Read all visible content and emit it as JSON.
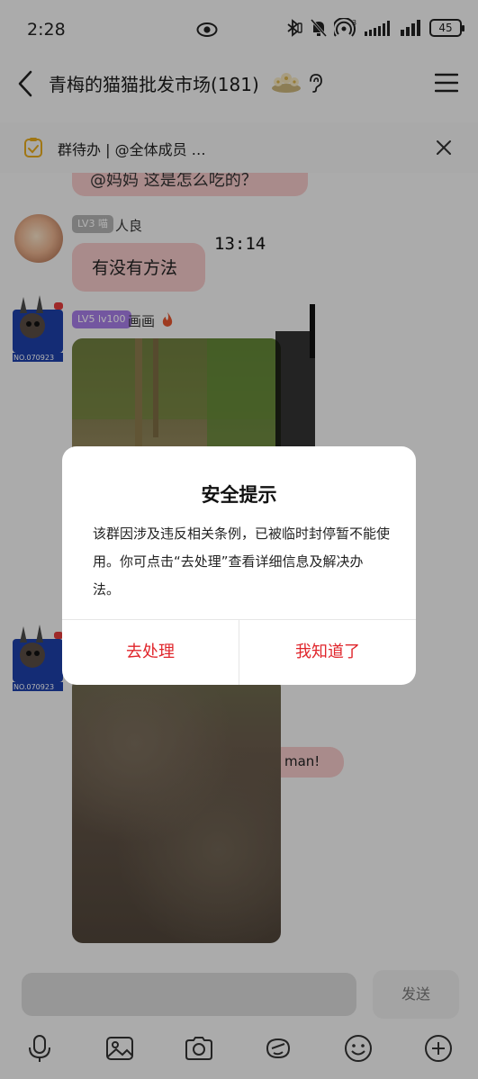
{
  "status_bar": {
    "time": "2:28",
    "battery": "45"
  },
  "header": {
    "title": "青梅的猫猫批发市场(181)"
  },
  "todo_bar": {
    "text": "群待办 | @全体成员 …"
  },
  "chat": {
    "top_bubble_text": "@妈妈 这是怎么吃的？",
    "message1": {
      "level": "LV3 喵",
      "sender": "人良",
      "text": "有没有方法",
      "handwritten_note": "13:14"
    },
    "message2": {
      "level": "LV5 lv100",
      "sender": "画画"
    },
    "avatar_badge": "NO.070923",
    "partial_bubble_text": "man!"
  },
  "input": {
    "send_label": "发送"
  },
  "dialog": {
    "title": "安全提示",
    "body": "该群因涉及违反相关条例，已被临时封停暂不能使用。你可点击“去处理”查看详细信息及解决办法。",
    "left_button": "去处理",
    "right_button": "我知道了"
  },
  "colors": {
    "accent_red": "#e0262c",
    "bubble_pink": "#f3c7c7",
    "level_purple": "#a57ce6"
  },
  "icons": [
    "eye-icon",
    "bluetooth-icon",
    "mute-icon",
    "hotspot-icon",
    "signal-icon",
    "battery-icon",
    "back-icon",
    "ear-icon",
    "menu-icon",
    "todo-icon",
    "close-icon",
    "microphone-icon",
    "image-icon",
    "camera-icon",
    "sticker-icon",
    "emoji-icon",
    "plus-icon"
  ]
}
